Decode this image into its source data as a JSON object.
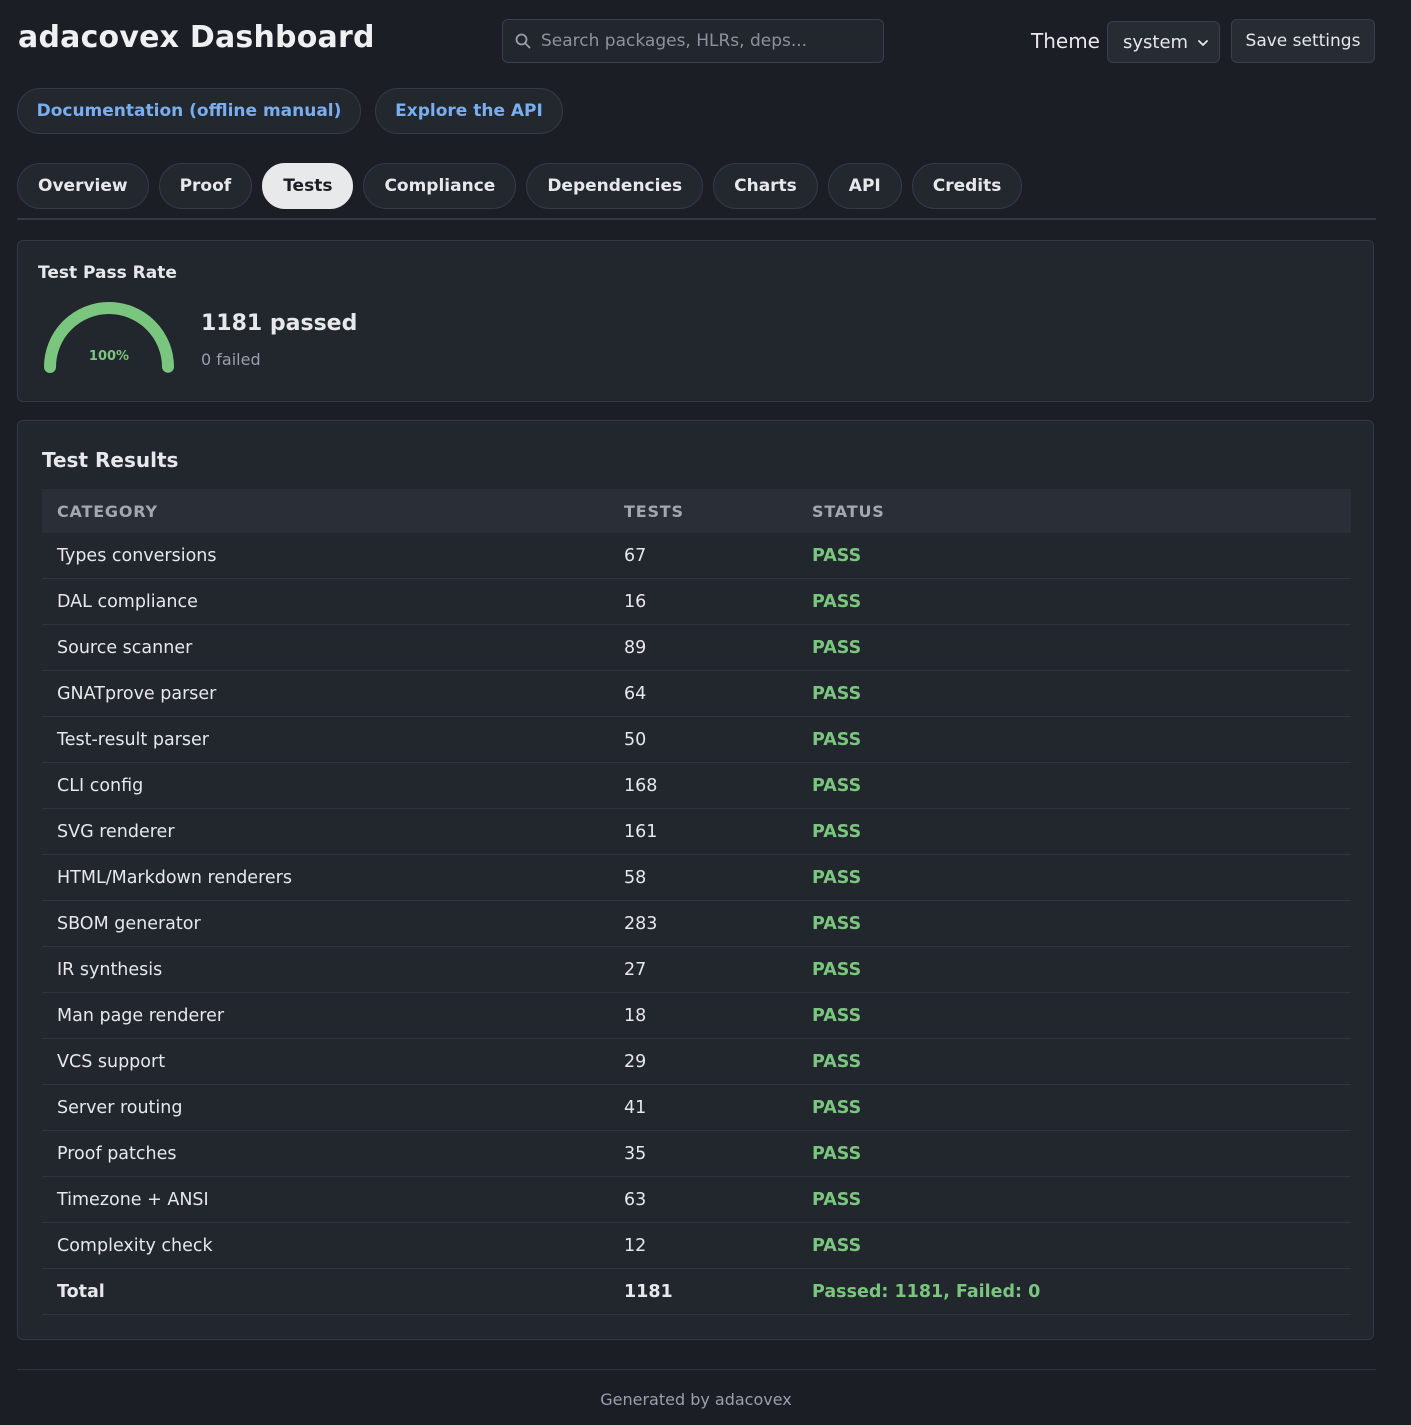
{
  "header": {
    "title": "adacovex Dashboard",
    "search_placeholder": "Search packages, HLRs, deps...",
    "theme_label": "Theme",
    "theme_value": "system",
    "save_label": "Save settings"
  },
  "links": {
    "docs": "Documentation (offline manual)",
    "api": "Explore the API"
  },
  "tabs": [
    "Overview",
    "Proof",
    "Tests",
    "Compliance",
    "Dependencies",
    "Charts",
    "API",
    "Credits"
  ],
  "active_tab": "Tests",
  "pass_rate": {
    "title": "Test Pass Rate",
    "percent_label": "100%",
    "fraction": 1.0,
    "passed": "1181 passed",
    "failed": "0 failed"
  },
  "results": {
    "title": "Test Results",
    "columns": [
      "CATEGORY",
      "TESTS",
      "STATUS"
    ],
    "rows": [
      {
        "category": "Types conversions",
        "tests": "67",
        "status": "PASS"
      },
      {
        "category": "DAL compliance",
        "tests": "16",
        "status": "PASS"
      },
      {
        "category": "Source scanner",
        "tests": "89",
        "status": "PASS"
      },
      {
        "category": "GNATprove parser",
        "tests": "64",
        "status": "PASS"
      },
      {
        "category": "Test-result parser",
        "tests": "50",
        "status": "PASS"
      },
      {
        "category": "CLI config",
        "tests": "168",
        "status": "PASS"
      },
      {
        "category": "SVG renderer",
        "tests": "161",
        "status": "PASS"
      },
      {
        "category": "HTML/Markdown renderers",
        "tests": "58",
        "status": "PASS"
      },
      {
        "category": "SBOM generator",
        "tests": "283",
        "status": "PASS"
      },
      {
        "category": "IR synthesis",
        "tests": "27",
        "status": "PASS"
      },
      {
        "category": "Man page renderer",
        "tests": "18",
        "status": "PASS"
      },
      {
        "category": "VCS support",
        "tests": "29",
        "status": "PASS"
      },
      {
        "category": "Server routing",
        "tests": "41",
        "status": "PASS"
      },
      {
        "category": "Proof patches",
        "tests": "35",
        "status": "PASS"
      },
      {
        "category": "Timezone + ANSI",
        "tests": "63",
        "status": "PASS"
      },
      {
        "category": "Complexity check",
        "tests": "12",
        "status": "PASS"
      }
    ],
    "total": {
      "label": "Total",
      "tests": "1181",
      "status": "Passed: 1181, Failed: 0"
    }
  },
  "footer": "Generated by adacovex",
  "colors": {
    "background": "#1b1e24",
    "card": "#22262d",
    "accent_link": "#79aef0",
    "pass_green": "#7bc67e",
    "active_tab_bg": "#e8e9eb"
  },
  "icons": {
    "search": "search-icon",
    "select": "chevron-down-icon"
  }
}
